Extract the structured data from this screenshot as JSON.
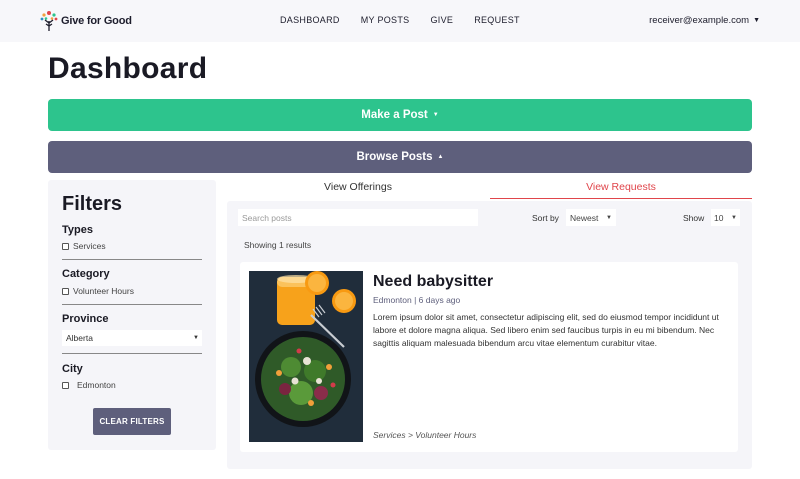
{
  "brand": {
    "name": "Give for Good"
  },
  "nav": {
    "links": [
      "DASHBOARD",
      "MY POSTS",
      "GIVE",
      "REQUEST"
    ],
    "user": "receiver@example.com"
  },
  "page": {
    "title": "Dashboard"
  },
  "actions": {
    "make_post": "Make a Post",
    "browse_posts": "Browse Posts"
  },
  "filters": {
    "title": "Filters",
    "types": {
      "label": "Types",
      "options": [
        "Services"
      ]
    },
    "category": {
      "label": "Category",
      "options": [
        "Volunteer Hours"
      ]
    },
    "province": {
      "label": "Province",
      "selected": "Alberta"
    },
    "city": {
      "label": "City",
      "options": [
        "Edmonton"
      ]
    },
    "clear_label": "CLEAR FILTERS"
  },
  "tabs": {
    "offerings": "View Offerings",
    "requests": "View Requests",
    "active": "requests"
  },
  "results": {
    "search_placeholder": "Search posts",
    "sort_label": "Sort by",
    "sort_selected": "Newest",
    "show_label": "Show",
    "show_selected": "10",
    "count_text": "Showing 1 results",
    "posts": [
      {
        "title": "Need babysitter",
        "meta": "Edmonton | 6 days ago",
        "description": "Lorem ipsum dolor sit amet, consectetur adipiscing elit, sed do eiusmod tempor incididunt ut labore et dolore magna aliqua. Sed libero enim sed faucibus turpis in eu mi bibendum. Nec sagittis aliquam malesuada bibendum arcu vitae elementum curabitur vitae.",
        "tag": "Services > Volunteer Hours"
      }
    ]
  },
  "colors": {
    "primary_green": "#2dc48d",
    "slate": "#5e5f7c",
    "accent_red": "#e0454b",
    "panel_bg": "#f5f5f9"
  }
}
